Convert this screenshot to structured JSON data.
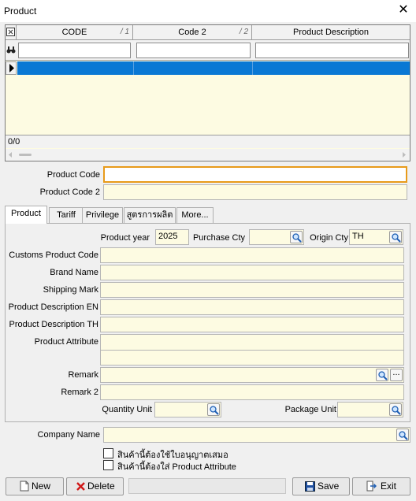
{
  "window": {
    "title": "Product",
    "close_icon": "close-icon"
  },
  "grid": {
    "columns": [
      {
        "label": "CODE",
        "index": "1"
      },
      {
        "label": "Code 2",
        "index": "2"
      },
      {
        "label": "Product Description",
        "index": ""
      }
    ],
    "status": "0/0"
  },
  "form": {
    "product_code_label": "Product Code",
    "product_code_value": "",
    "product_code2_label": "Product Code 2",
    "product_code2_value": ""
  },
  "tabs": [
    "Product",
    "Tariff",
    "Privilege",
    "สูตรการผลิต",
    "More..."
  ],
  "product_tab": {
    "product_year_label": "Product year",
    "product_year_value": "2025",
    "purchase_cty_label": "Purchase Cty",
    "purchase_cty_value": "",
    "origin_cty_label": "Origin Cty",
    "origin_cty_value": "TH",
    "customs_product_code_label": "Customs Product Code",
    "brand_name_label": "Brand Name",
    "shipping_mark_label": "Shipping Mark",
    "product_desc_en_label": "Product Description EN",
    "product_desc_th_label": "Product Description TH",
    "product_attribute_label": "Product Attribute",
    "remark_label": "Remark",
    "remark2_label": "Remark 2",
    "quantity_unit_label": "Quantity Unit",
    "package_unit_label": "Package Unit",
    "ellipsis": "..."
  },
  "company": {
    "label": "Company Name",
    "value": ""
  },
  "checks": {
    "permit_required": "สินค้านี้ต้องใช้ใบอนุญาตเสมอ",
    "attribute_required": "สินค้านี้ต้องใส่ Product Attribute"
  },
  "buttons": {
    "new": "New",
    "delete": "Delete",
    "save": "Save",
    "exit": "Exit"
  },
  "colors": {
    "field_bg": "#fdfbe2",
    "selection": "#0a78d4",
    "focus_border": "#e89b1a"
  }
}
